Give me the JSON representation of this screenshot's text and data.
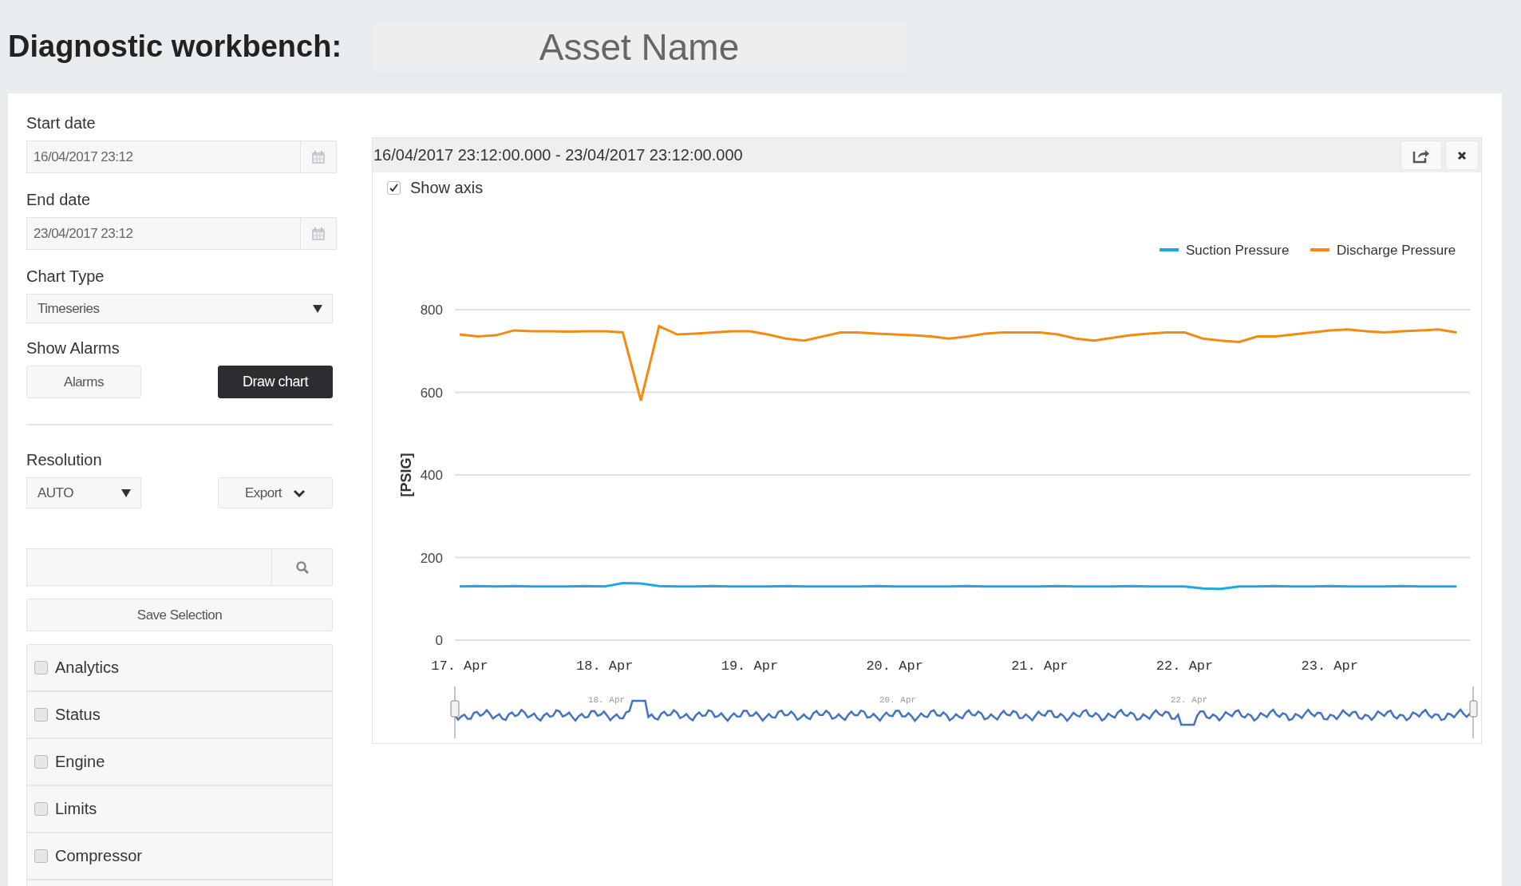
{
  "header": {
    "title": "Diagnostic workbench:",
    "asset_name": "Asset Name"
  },
  "sidebar": {
    "start_date": {
      "label": "Start date",
      "value": "16/04/2017 23:12"
    },
    "end_date": {
      "label": "End date",
      "value": "23/04/2017 23:12"
    },
    "chart_type": {
      "label": "Chart Type",
      "value": "Timeseries"
    },
    "show_alarms": {
      "label": "Show Alarms",
      "button": "Alarms"
    },
    "draw_chart_button": "Draw chart",
    "resolution": {
      "label": "Resolution",
      "value": "AUTO"
    },
    "export_button": "Export",
    "save_selection_button": "Save Selection",
    "groups": [
      {
        "label": "Analytics",
        "checked": false
      },
      {
        "label": "Status",
        "checked": false
      },
      {
        "label": "Engine",
        "checked": false
      },
      {
        "label": "Limits",
        "checked": false
      },
      {
        "label": "Compressor",
        "checked": false
      }
    ]
  },
  "chart_panel": {
    "title": "16/04/2017 23:12:00.000 - 23/04/2017 23:12:00.000",
    "show_axis": {
      "label": "Show axis",
      "checked": true
    },
    "navigator_labels": [
      "18. Apr",
      "20. Apr",
      "22. Apr"
    ],
    "chart_data": {
      "type": "line",
      "grid": true,
      "legend": "top-right",
      "ylabel": "[PSIG]",
      "categories": [
        "17. Apr",
        null,
        null,
        null,
        null,
        null,
        null,
        null,
        "18. Apr",
        null,
        null,
        null,
        null,
        null,
        null,
        null,
        "19. Apr",
        null,
        null,
        null,
        null,
        null,
        null,
        null,
        "20. Apr",
        null,
        null,
        null,
        null,
        null,
        null,
        null,
        "21. Apr",
        null,
        null,
        null,
        null,
        null,
        null,
        null,
        "22. Apr",
        null,
        null,
        null,
        null,
        null,
        null,
        null,
        "23. Apr",
        null,
        null,
        null,
        null,
        null,
        null,
        null
      ],
      "series": [
        {
          "name": "Suction Pressure",
          "color": "#1fa8e0",
          "values": [
            130,
            131,
            130,
            131,
            130,
            130,
            130,
            131,
            130,
            138,
            137,
            131,
            130,
            130,
            131,
            130,
            130,
            130,
            131,
            130,
            130,
            130,
            130,
            131,
            130,
            130,
            130,
            130,
            131,
            130,
            130,
            130,
            130,
            131,
            130,
            130,
            130,
            131,
            130,
            130,
            130,
            125,
            124,
            130,
            130,
            131,
            130,
            130,
            131,
            130,
            130,
            130,
            131,
            130,
            130,
            130
          ]
        },
        {
          "name": "Discharge Pressure",
          "color": "#f28a13",
          "values": [
            740,
            735,
            738,
            750,
            748,
            748,
            747,
            748,
            748,
            745,
            580,
            760,
            740,
            742,
            745,
            748,
            748,
            740,
            730,
            725,
            735,
            745,
            745,
            742,
            740,
            738,
            735,
            730,
            735,
            742,
            745,
            745,
            745,
            740,
            730,
            725,
            732,
            738,
            742,
            745,
            745,
            730,
            725,
            722,
            735,
            735,
            740,
            745,
            750,
            752,
            748,
            745,
            748,
            750,
            752,
            745
          ]
        }
      ],
      "ylim": [
        0,
        800
      ],
      "yticks": [
        0,
        200,
        400,
        600,
        800
      ]
    }
  }
}
